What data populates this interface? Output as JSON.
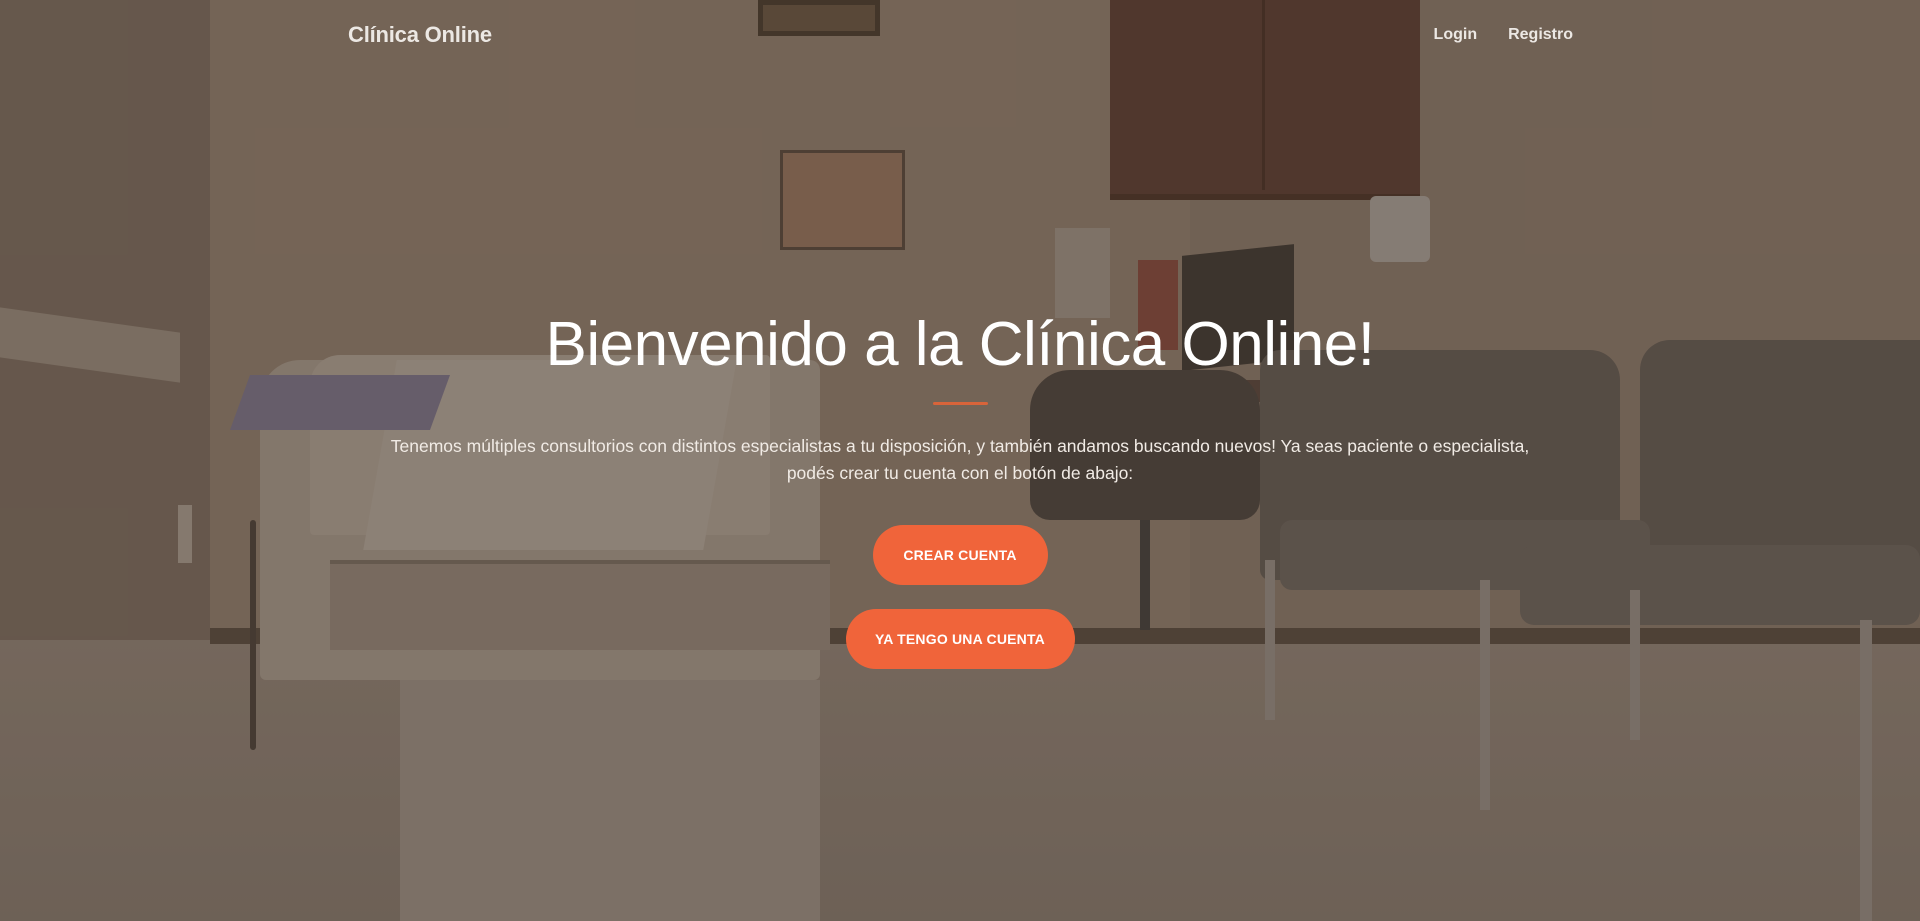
{
  "navbar": {
    "brand": "Clínica Online",
    "links": [
      {
        "label": "Login"
      },
      {
        "label": "Registro"
      }
    ]
  },
  "hero": {
    "title": "Bienvenido a la Clínica Online!",
    "lead_line1": "Tenemos múltiples consultorios con distintos especialistas a tu disposición, y también andamos buscando nuevos! Ya seas paciente o especialista,",
    "lead_line2": "podés crear tu cuenta con el botón de abajo:",
    "buttons": {
      "create": "CREAR CUENTA",
      "login": "YA TENGO UNA CUENTA"
    }
  },
  "colors": {
    "accent": "#f0643a",
    "overlay": "#564436",
    "text": "#ffffff"
  }
}
